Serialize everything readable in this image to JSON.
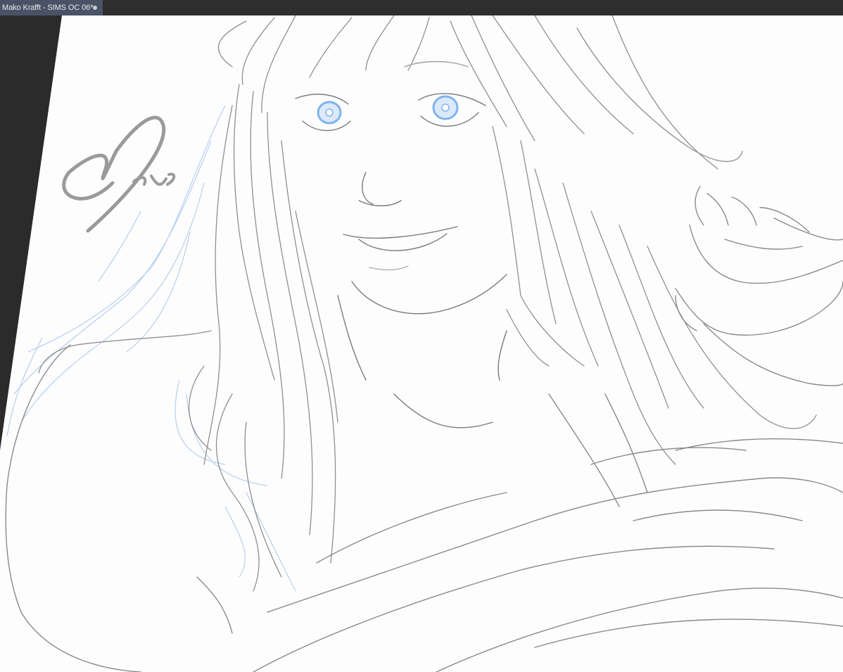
{
  "document_tab": {
    "title": "Mako Krafft - SIMS OC 06*",
    "unsaved": true
  },
  "canvas": {
    "content": "line-art-portrait",
    "signature": "Mako"
  },
  "colors": {
    "workspace": "#2b2b2b",
    "tab_active": "#4a5366",
    "paper": "#fdfdfd",
    "ink": "#8a8a8a",
    "sketch_blue": "#a9c8ee",
    "eye_blue": "#7fb3ef"
  }
}
